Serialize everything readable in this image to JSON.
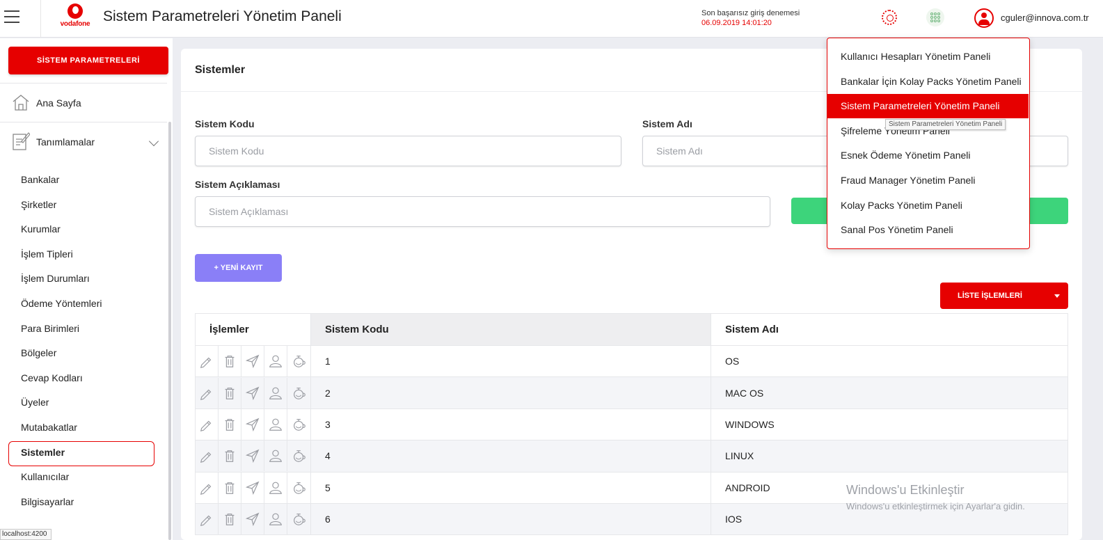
{
  "header": {
    "app_title": "Sistem Parametreleri Yönetim Paneli",
    "brand": "vodafone",
    "fail_login_label": "Son başarısız giriş denemesi",
    "fail_login_value": "06.09.2019 14:01:20",
    "user_email": "cguler@innova.com.tr"
  },
  "sidebar": {
    "system_button": "SİSTEM PARAMETRELERİ",
    "home_label": "Ana Sayfa",
    "definitions_label": "Tanımlamalar",
    "items": [
      "Bankalar",
      "Şirketler",
      "Kurumlar",
      "İşlem Tipleri",
      "İşlem Durumları",
      "Ödeme Yöntemleri",
      "Para Birimleri",
      "Bölgeler",
      "Cevap Kodları",
      "Üyeler",
      "Mutabakatlar",
      "Sistemler",
      "Kullanıcılar",
      "Bilgisayarlar"
    ],
    "active_item": "Sistemler"
  },
  "status_url": "localhost:4200",
  "main": {
    "title": "Sistemler",
    "fields": {
      "code_label": "Sistem Kodu",
      "code_placeholder": "Sistem Kodu",
      "name_label": "Sistem Adı",
      "name_placeholder": "Sistem Adı",
      "desc_label": "Sistem Açıklaması",
      "desc_placeholder": "Sistem Açıklaması"
    },
    "new_button": "+ YENİ KAYIT",
    "list_button": "LİSTE İŞLEMLERİ",
    "table": {
      "headers": [
        "İşlemler",
        "Sistem Kodu",
        "Sistem Adı"
      ],
      "rows": [
        {
          "code": "1",
          "name": "OS"
        },
        {
          "code": "2",
          "name": "MAC OS"
        },
        {
          "code": "3",
          "name": "WINDOWS"
        },
        {
          "code": "4",
          "name": "LINUX"
        },
        {
          "code": "5",
          "name": "ANDROID"
        },
        {
          "code": "6",
          "name": "IOS"
        }
      ],
      "row_action_icons": [
        "pencil-icon",
        "trash-icon",
        "send-icon",
        "user-icon",
        "teapot-icon"
      ]
    }
  },
  "apps_menu": {
    "items": [
      "Kullanıcı Hesapları Yönetim Paneli",
      "Bankalar İçin Kolay Packs Yönetim Paneli",
      "Sistem Parametreleri Yönetim Paneli",
      "Şifreleme Yönetim Paneli",
      "Esnek Ödeme Yönetim Paneli",
      "Fraud Manager Yönetim Paneli",
      "Kolay Packs Yönetim Paneli",
      "Sanal Pos Yönetim Paneli"
    ],
    "active_item": "Sistem Parametreleri Yönetim Paneli",
    "tooltip": "Sistem Parametreleri Yönetim Paneli"
  },
  "watermark": {
    "line1": "Windows'u Etkinleştir",
    "line2": "Windows'u etkinleştirmek için Ayarlar'a gidin."
  },
  "colors": {
    "brand_red": "#e60000",
    "new_button": "#8a7ff7",
    "green_button": "#3dd47b"
  }
}
